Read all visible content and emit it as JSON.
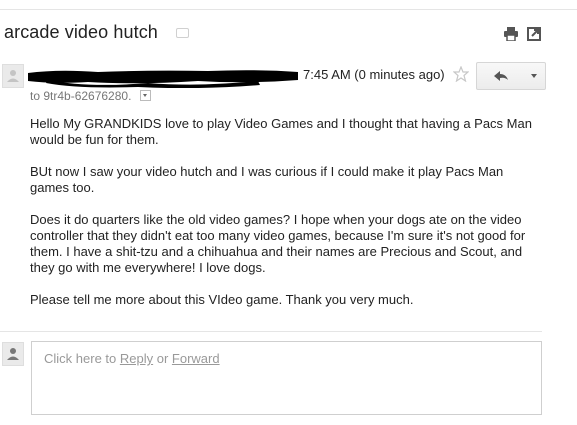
{
  "subject": "arcade video hutch",
  "icons": {
    "label": "label-icon",
    "print": "print-icon",
    "new_window": "new-window-icon",
    "star": "star-icon",
    "reply": "reply-icon",
    "more": "chevron-down-icon",
    "avatar": "person-icon"
  },
  "message": {
    "sender": "[redacted]",
    "time": "7:45 AM (0 minutes ago)",
    "to": "to 9tr4b-62676280.",
    "paragraphs": [
      "Hello My GRANDKIDS love to play Video Games and I thought that having a Pacs Man would be fun for them.",
      "BUt now I saw your video hutch and I was curious if I could make it play Pacs Man games too.",
      "Does it do quarters like the old video games?  I hope when your dogs ate on the video controller that they didn't eat too many video games, because I'm sure it's not good for them.  I have a shit-tzu and a chihuahua and their names are Precious and Scout, and they go with me everywhere!  I love dogs.",
      "Please tell me more about this VIdeo game.  Thank you very much."
    ]
  },
  "reply_box": {
    "prefix": "Click here to ",
    "reply_link": "Reply",
    "middle": " or ",
    "forward_link": "Forward"
  },
  "colors": {
    "text": "#222222",
    "muted": "#777777",
    "border": "#d6d6d6"
  }
}
